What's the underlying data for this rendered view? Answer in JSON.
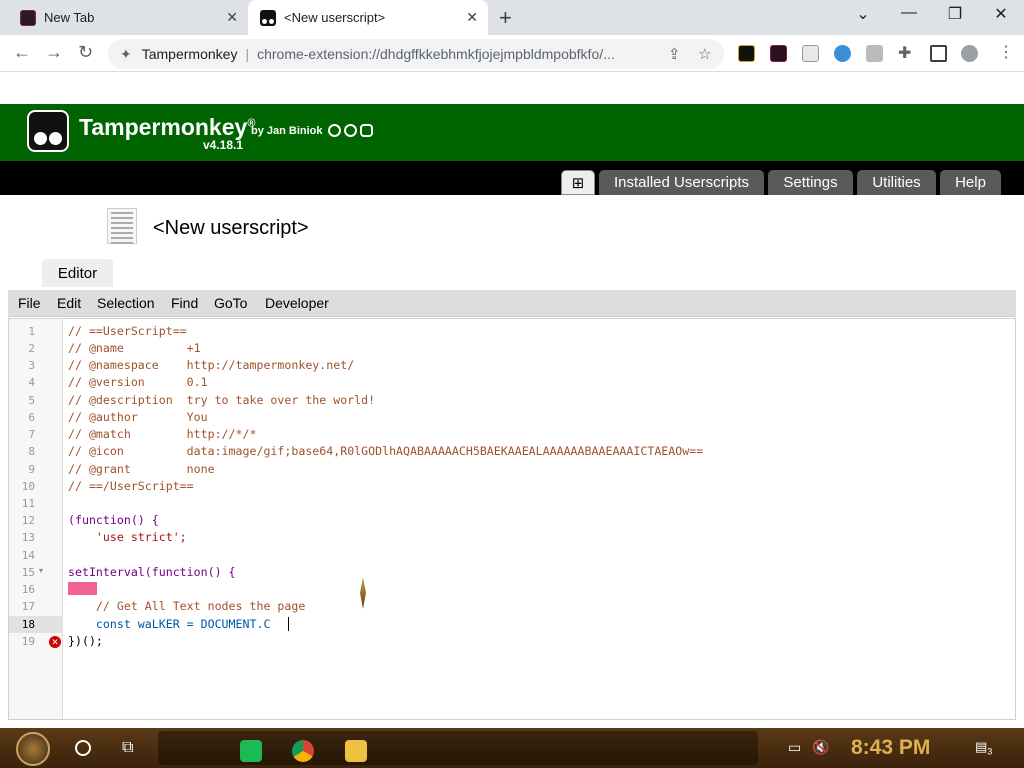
{
  "browser": {
    "tabs": [
      {
        "title": "New Tab",
        "active": false
      },
      {
        "title": "<New userscript>",
        "active": true
      }
    ],
    "new_tab_symbol": "+",
    "close_symbol": "✕",
    "window_controls": {
      "minimize": "—",
      "restore": "❐",
      "close": "✕",
      "tab_search": "⌄"
    },
    "address": {
      "site_label": "Tampermonkey",
      "url": "chrome-extension://dhdgffkkebhmkfjojejmpbldmpobfkfo/..."
    }
  },
  "tampermonkey": {
    "brand": "Tampermonkey",
    "registered": "®",
    "by": "by Jan Biniok",
    "version": "v4.18.1",
    "nav": {
      "add_symbol": "⊞",
      "installed": "Installed Userscripts",
      "settings": "Settings",
      "utilities": "Utilities",
      "help": "Help"
    },
    "script_title": "<New userscript>",
    "editor_tab": "Editor",
    "menu": [
      "File",
      "Edit",
      "Selection",
      "Find",
      "GoTo",
      "Developer"
    ]
  },
  "code": {
    "line_numbers": [
      "1",
      "2",
      "3",
      "4",
      "5",
      "6",
      "7",
      "8",
      "9",
      "10",
      "11",
      "12",
      "13",
      "14",
      "15",
      "16",
      "17",
      "18",
      "19"
    ],
    "active_line": "18",
    "lines": [
      "// ==UserScript==",
      "// @name         +1",
      "// @namespace    http://tampermonkey.net/",
      "// @version      0.1",
      "// @description  try to take over the world!",
      "// @author       You",
      "// @match        http://*/*",
      "// @icon         data:image/gif;base64,R0lGODlhAQABAAAAACH5BAEKAAEALAAAAAABAAEAAAICTAEAOw==",
      "// @grant        none",
      "// ==/UserScript==",
      "",
      "(function() {",
      "    'use strict';",
      "",
      "setInterval(function() {",
      "",
      "    // Get All Text nodes the page",
      "    const waLKER = DOCUMENT.C",
      "})();"
    ],
    "error_marker": "✕",
    "fold_marker": "▾"
  },
  "taskbar": {
    "time": "8:43 PM",
    "notification_count": "3"
  }
}
